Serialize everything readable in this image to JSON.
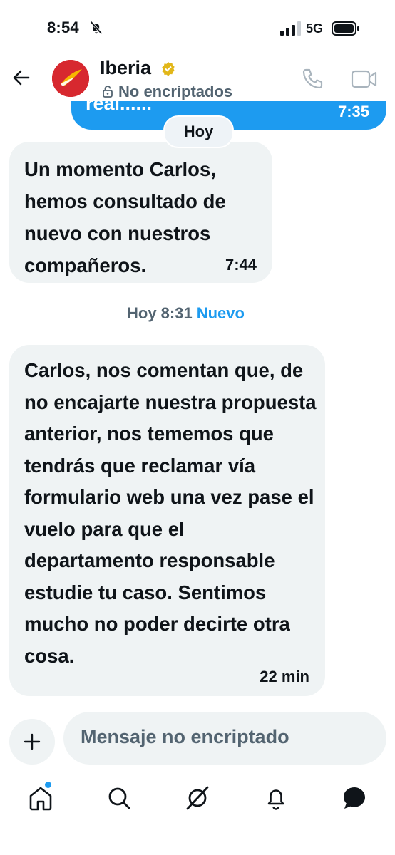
{
  "status_bar": {
    "time": "8:54",
    "network": "5G"
  },
  "header": {
    "title": "Iberia",
    "subtitle": "No encriptados",
    "icons": [
      "back-arrow-icon",
      "verified-badge-icon",
      "lock-icon",
      "phone-icon",
      "video-icon"
    ]
  },
  "conversation": {
    "previous_message": {
      "text": "real......",
      "time": "7:35"
    },
    "day_label": "Hoy",
    "messages": [
      {
        "text": "Un momento Carlos, hemos consultado de nuevo con nuestros compañeros.",
        "time": "7:44"
      },
      {
        "text": "Carlos, nos comentan que, de no encajarte nuestra propuesta anterior, nos tememos que tendrás que reclamar vía formulario web una vez pase el vuelo para que el departamento responsable estudie tu caso. Sentimos mucho no poder decirte otra cosa.",
        "time": "22 min"
      }
    ],
    "divider": {
      "label": "Hoy 8:31",
      "new_label": "Nuevo"
    }
  },
  "composer": {
    "placeholder": "Mensaje no encriptado"
  },
  "tab_bar": {
    "items": [
      "home-icon",
      "search-icon",
      "grok-icon",
      "notifications-icon",
      "messages-icon"
    ],
    "accent": "#1d9bf0"
  },
  "colors": {
    "sent_bubble": "#1d9bf0",
    "received_bubble": "#eff3f4",
    "brand_red": "#d7282f"
  }
}
